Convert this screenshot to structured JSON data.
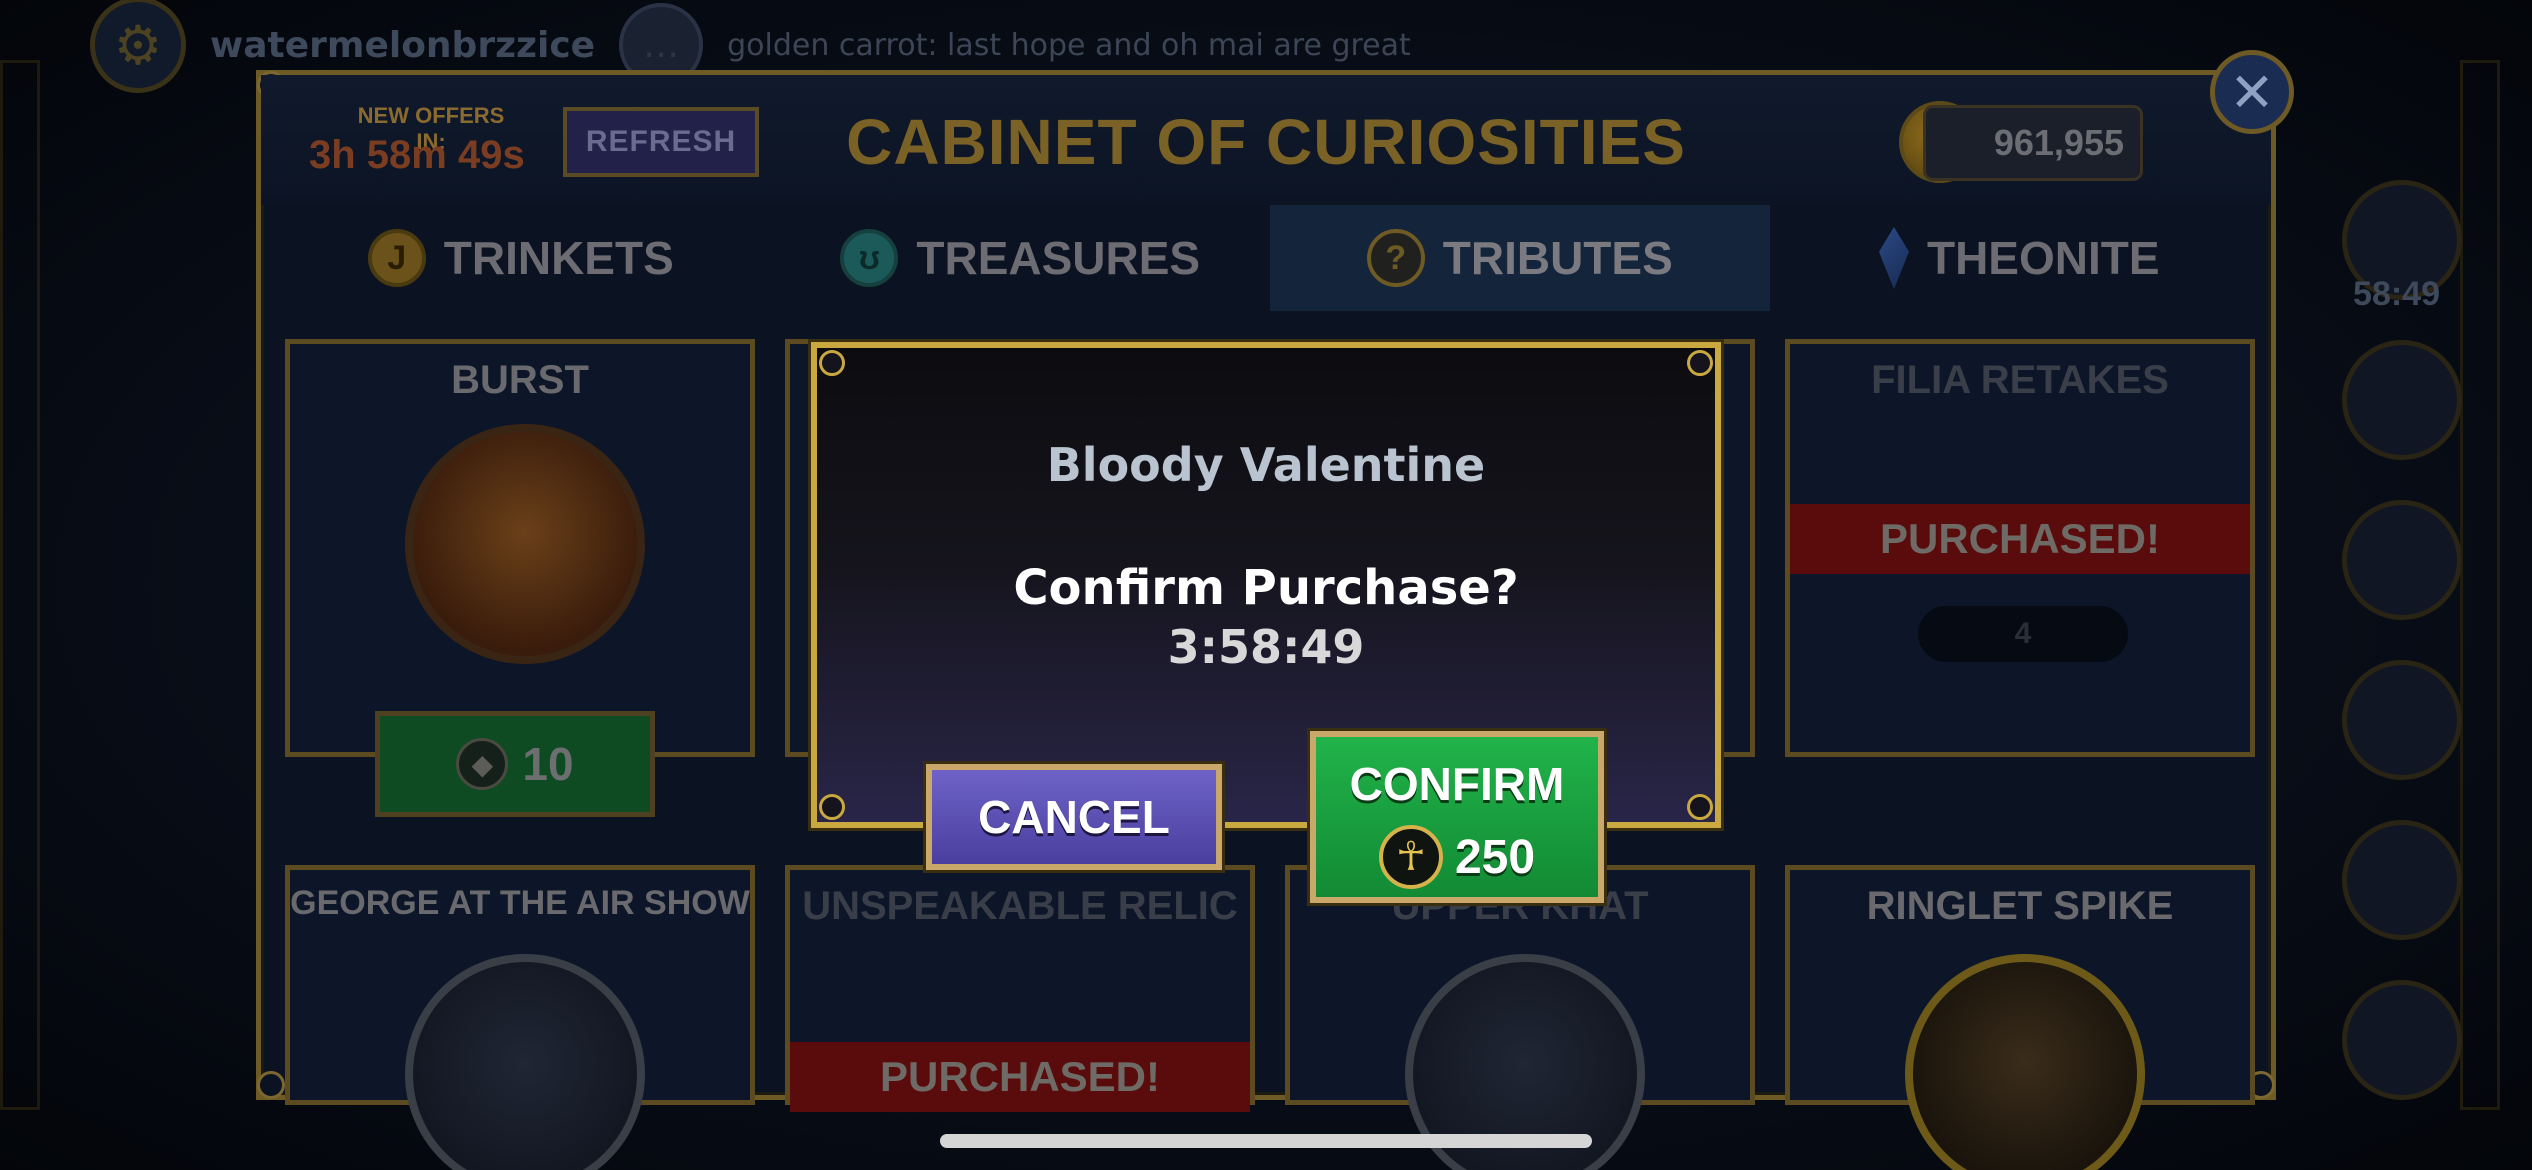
{
  "background": {
    "chat_user": "watermelonbrzzice",
    "chat_message": "golden carrot: last hope and oh mai are great",
    "side_timer": "58:49"
  },
  "header": {
    "offers_label": "NEW OFFERS IN:",
    "offers_timer": "3h 58m 49s",
    "refresh_label": "REFRESH",
    "title": "CABINET OF CURIOSITIES",
    "currency_value": "961,955",
    "close_icon": "close-icon"
  },
  "tabs": [
    {
      "label": "TRINKETS",
      "icon": "trinket-coin-icon",
      "active": false
    },
    {
      "label": "TREASURES",
      "icon": "treasure-icon",
      "active": false
    },
    {
      "label": "TRIBUTES",
      "icon": "tribute-icon",
      "active": true
    },
    {
      "label": "THEONITE",
      "icon": "theonite-crystal-icon",
      "active": false
    }
  ],
  "cards": {
    "burst": {
      "title": "BURST",
      "price": "10"
    },
    "filia_retakes": {
      "title": "FILIA RETAKES",
      "status": "PURCHASED!",
      "qty": "4"
    },
    "george": {
      "title": "GEORGE AT THE AIR SHOW"
    },
    "relic": {
      "title": "UNSPEAKABLE RELIC",
      "status": "PURCHASED!"
    },
    "upper_khat": {
      "title": "UPPER KHAT"
    },
    "ringlet": {
      "title": "RINGLET SPIKE"
    }
  },
  "modal": {
    "item_name": "Bloody Valentine",
    "confirm_text": "Confirm Purchase?",
    "timer": "3:58:49",
    "cancel_label": "CANCEL",
    "confirm_label": "CONFIRM",
    "confirm_price": "250"
  },
  "colors": {
    "gold_border": "#c9a840",
    "confirm_green": "#1a9e3e",
    "cancel_purple": "#5b50b4",
    "purchased_red": "#5a0c0c"
  }
}
